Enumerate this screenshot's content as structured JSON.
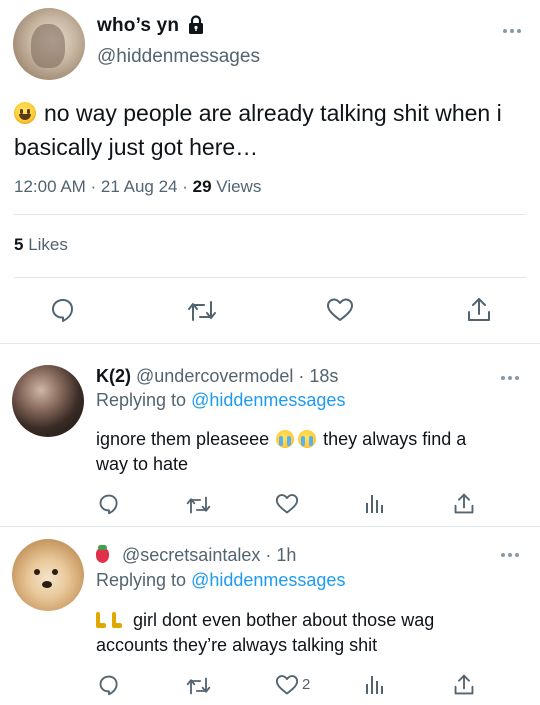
{
  "main_tweet": {
    "display_name": "who’s yn",
    "handle": "@hiddenmessages",
    "text": "no way people are already talking shit when i basically just got here…",
    "time": "12:00 AM · 21 Aug 24 ·",
    "views_count": "29",
    "views_label": "Views",
    "likes_count": "5",
    "likes_label": "Likes",
    "icons": [
      "lock-icon",
      "more-icon",
      "reply-icon",
      "retweet-icon",
      "like-icon",
      "share-icon"
    ]
  },
  "replies": [
    {
      "name": "K(2)",
      "handle": "@undercovermodel · 18s",
      "replying_prefix": "Replying to",
      "replying_to": "@hiddenmessages",
      "text_part1": "ignore them pleaseee",
      "text_part2": "they always find a",
      "text_line2": "way to hate",
      "like_count": ""
    },
    {
      "name": "",
      "handle": "@secretsaintalex · 1h",
      "replying_prefix": "Replying to",
      "replying_to": "@hiddenmessages",
      "text_line1": "girl dont even bother about those wag",
      "text_line2": "accounts they’re always talking shit",
      "like_count": "2"
    }
  ],
  "colors": {
    "text": "#0f1419",
    "muted": "#536471",
    "link": "#1d9bf0",
    "divider": "#e1e8ed"
  }
}
